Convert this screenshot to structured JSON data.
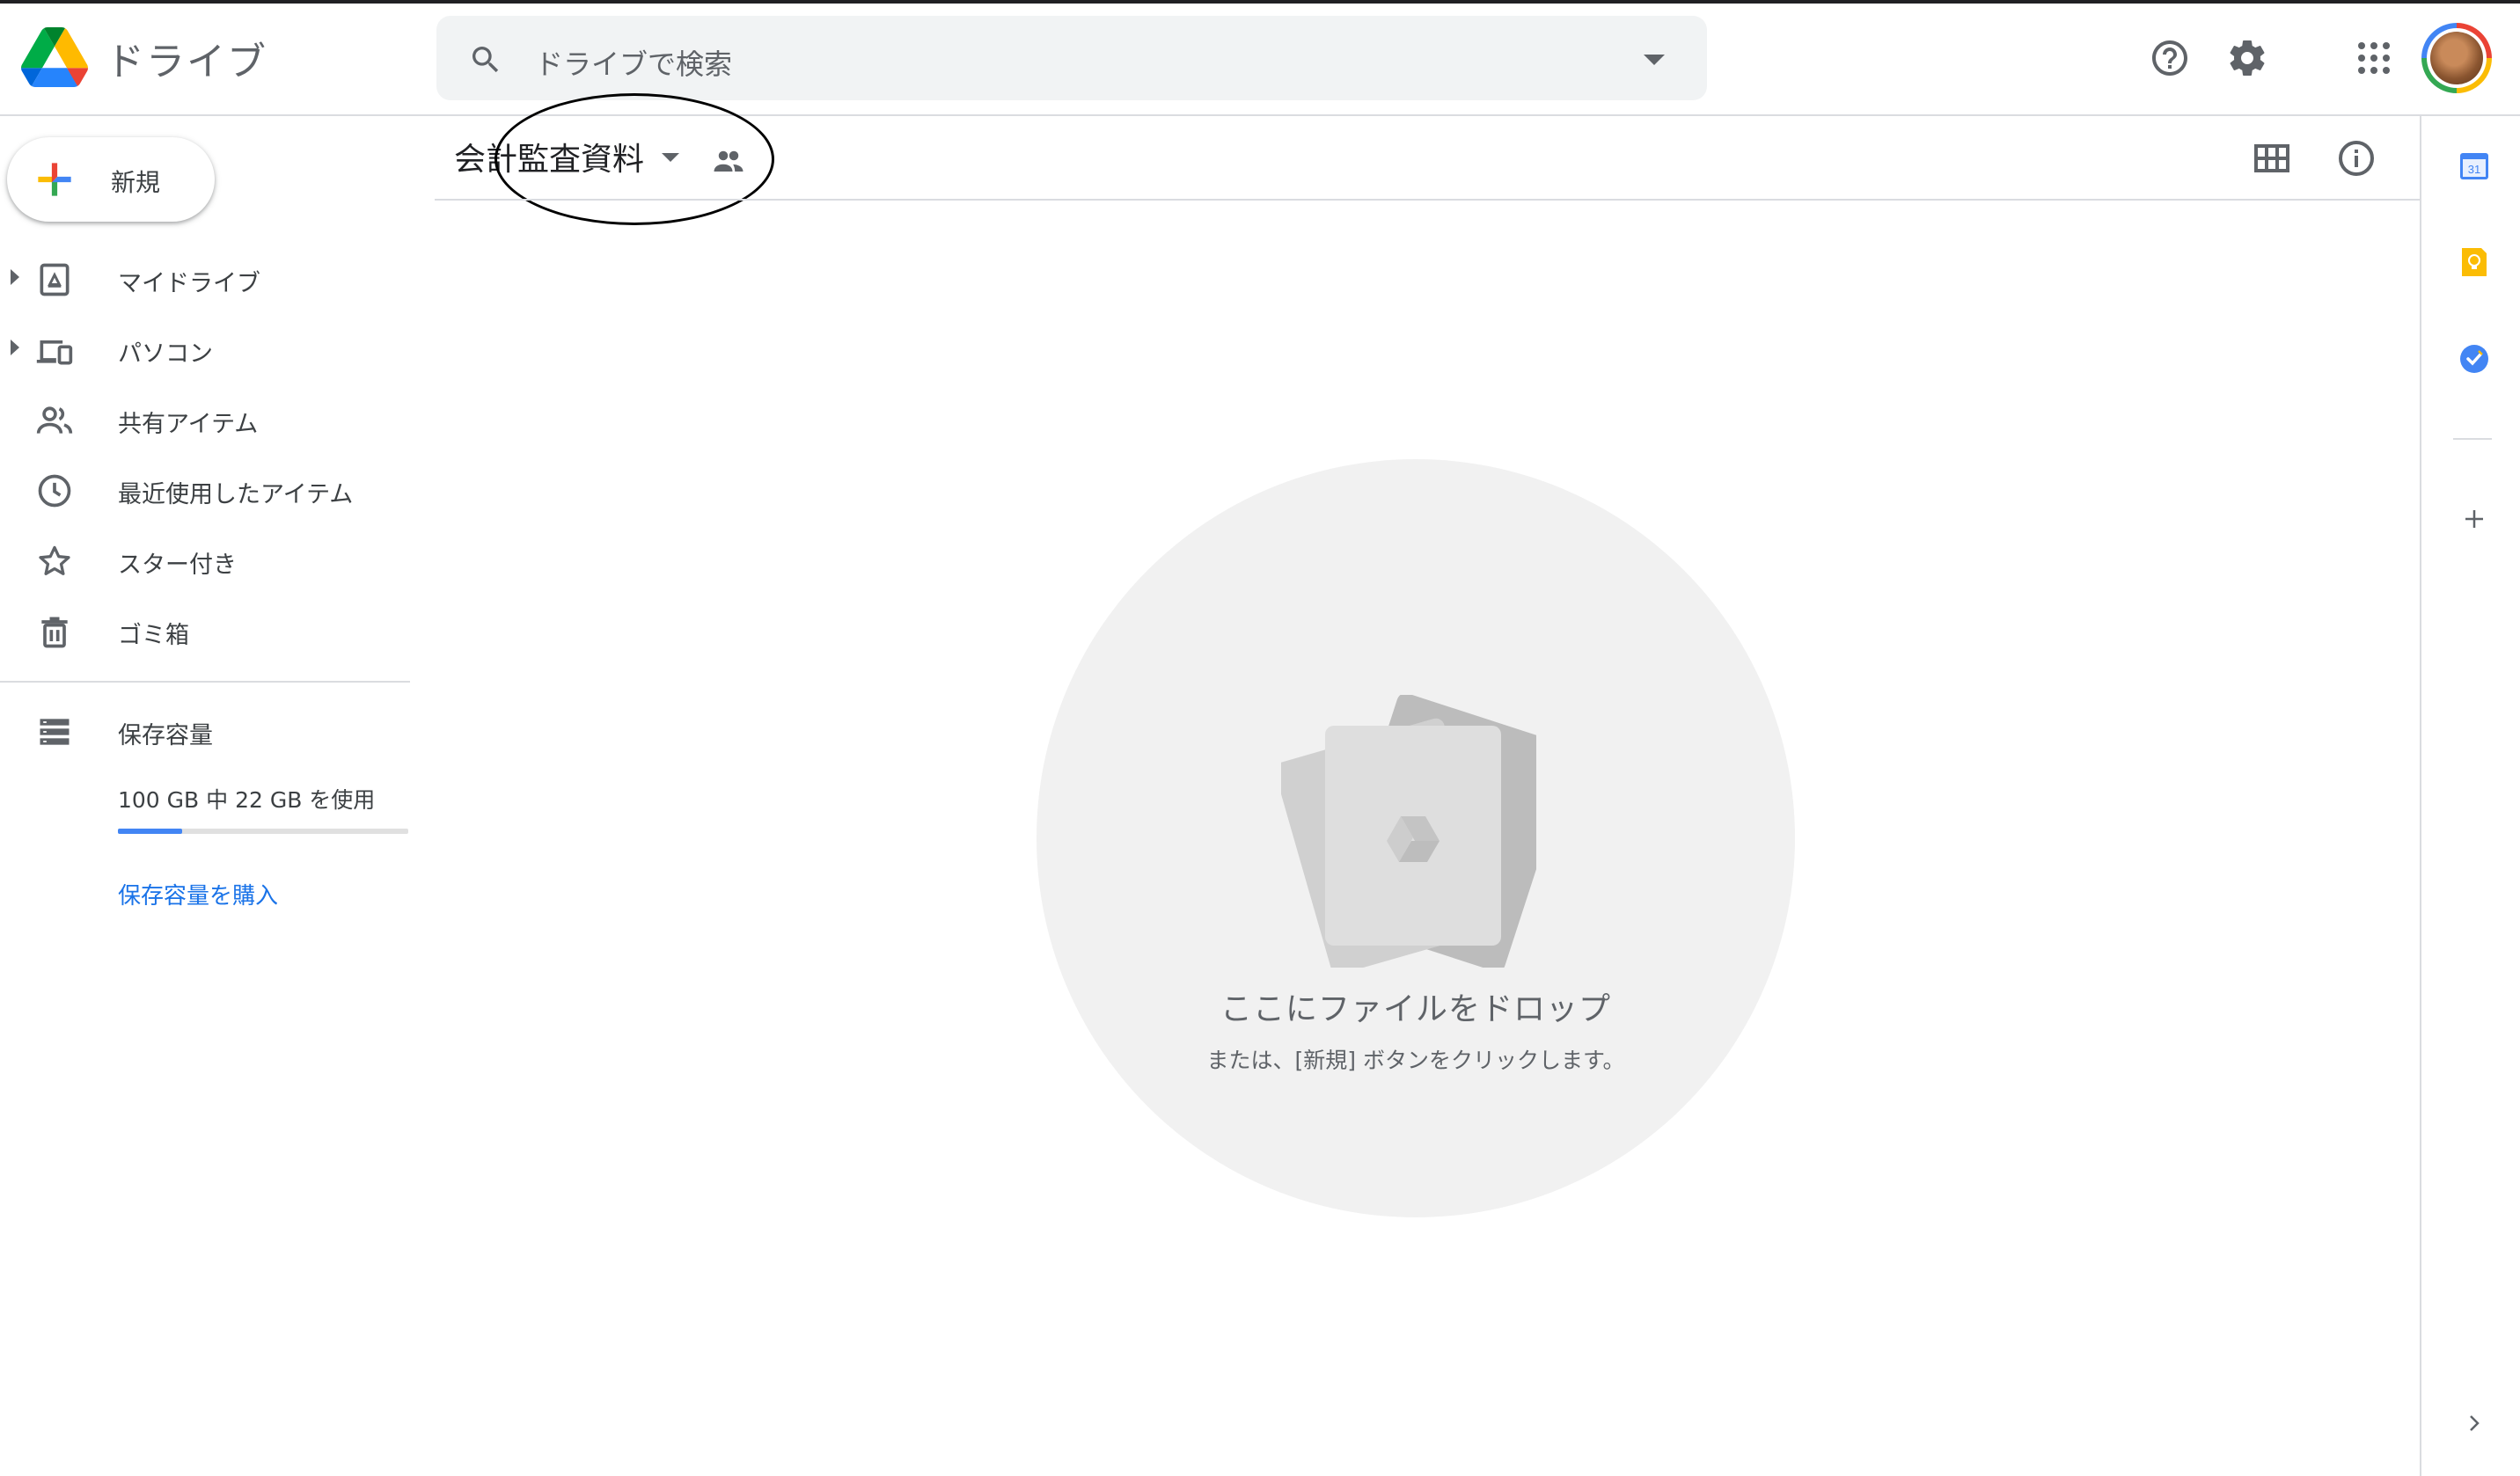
{
  "header": {
    "app_title": "ドライブ",
    "search_placeholder": "ドライブで検索",
    "icons": [
      "help-icon",
      "settings-icon",
      "apps-grid-icon",
      "account-avatar"
    ]
  },
  "sidebar": {
    "new_button": "新規",
    "items": [
      {
        "label": "マイドライブ",
        "icon": "my-drive-icon",
        "expandable": true
      },
      {
        "label": "パソコン",
        "icon": "computers-icon",
        "expandable": true
      },
      {
        "label": "共有アイテム",
        "icon": "shared-people-icon",
        "expandable": false
      },
      {
        "label": "最近使用したアイテム",
        "icon": "clock-icon",
        "expandable": false
      },
      {
        "label": "スター付き",
        "icon": "star-icon",
        "expandable": false
      },
      {
        "label": "ゴミ箱",
        "icon": "trash-icon",
        "expandable": false
      }
    ],
    "storage": {
      "label": "保存容量",
      "usage_text": "100 GB 中 22 GB を使用",
      "used_fraction": 0.22,
      "buy_link": "保存容量を購入"
    }
  },
  "main": {
    "folder_name": "会計監査資料",
    "empty_state": {
      "title": "ここにファイルをドロップ",
      "subtitle": "または、[新規] ボタンをクリックします。"
    }
  },
  "side_panel": {
    "calendar_day": "31",
    "icons": [
      "calendar-icon",
      "keep-icon",
      "tasks-icon",
      "add-addon-icon",
      "expand-panel-icon"
    ]
  },
  "colors": {
    "accent_blue": "#1a73e8",
    "storage_bar": "#4285f4",
    "drive_green": "#0f9d58",
    "drive_yellow": "#f4b400",
    "drive_blue": "#4285f4"
  }
}
